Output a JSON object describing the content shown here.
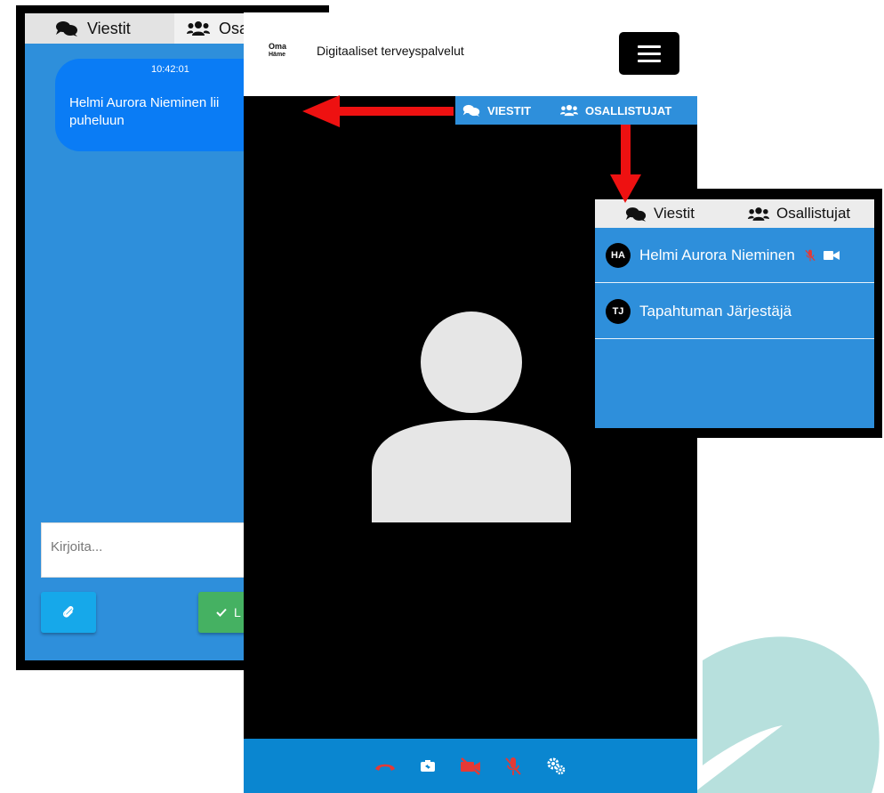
{
  "colors": {
    "panel_blue": "#2e8fdb",
    "message_blue": "#0a7cf5",
    "toolbar_blue": "#0a86d0",
    "send_green": "#45b162",
    "attach_blue": "#16a8ea",
    "danger_red": "#e53935",
    "arrow_red": "#ee1111",
    "leaf_teal": "#b7e0dd"
  },
  "chat": {
    "tabs": [
      {
        "label": "Viestit",
        "icon": "comments-icon"
      },
      {
        "label": "Osa",
        "icon": "users-icon"
      }
    ],
    "message": {
      "time": "10:42:01",
      "text": "Helmi Aurora Nieminen lii\npuheluun"
    },
    "input_placeholder": "Kirjoita...",
    "attach_icon": "paperclip-icon",
    "send_label": "L"
  },
  "call": {
    "logo_line1": "Oma",
    "logo_line2": "Häme",
    "title": "Digitaaliset terveyspalvelut",
    "tabs": [
      {
        "label": "VIESTIT",
        "icon": "comments-icon"
      },
      {
        "label": "OSALLISTUJAT",
        "icon": "users-icon"
      }
    ],
    "toolbar": [
      "hangup-icon",
      "switch-camera-icon",
      "camera-off-icon",
      "mic-off-icon",
      "settings-icon"
    ]
  },
  "participants": {
    "tabs": [
      {
        "label": "Viestit",
        "icon": "comments-icon"
      },
      {
        "label": "Osallistujat",
        "icon": "users-icon"
      }
    ],
    "list": [
      {
        "initials": "HA",
        "name": "Helmi Aurora Nieminen",
        "muted": true,
        "video": true
      },
      {
        "initials": "TJ",
        "name": "Tapahtuman Järjestäjä",
        "muted": false,
        "video": false
      }
    ]
  }
}
